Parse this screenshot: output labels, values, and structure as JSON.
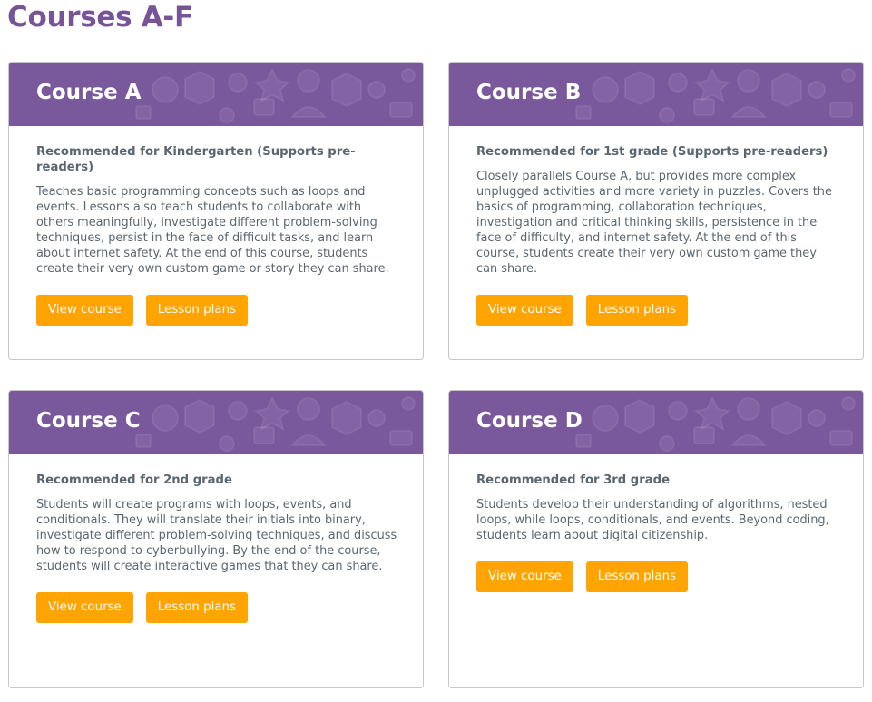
{
  "page_title": "Courses A-F",
  "colors": {
    "title": "#765496",
    "header_bg": "#7a589c",
    "button_bg": "#ffa400",
    "text": "#5b6770"
  },
  "cards": [
    {
      "title": "Course A",
      "subtitle": "Recommended for Kindergarten (Supports pre-readers)",
      "description": "Teaches basic programming concepts such as loops and events. Lessons also teach students to collaborate with others meaningfully, investigate different problem-solving techniques, persist in the face of difficult tasks, and learn about internet safety. At the end of this course, students create their very own custom game or story they can share.",
      "view_label": "View course",
      "lesson_label": "Lesson plans"
    },
    {
      "title": "Course B",
      "subtitle": "Recommended for 1st grade (Supports pre-readers)",
      "description": "Closely parallels Course A, but provides more complex unplugged activities and more variety in puzzles. Covers the basics of programming, collaboration techniques, investigation and critical thinking skills, persistence in the face of difficulty, and internet safety. At the end of this course, students create their very own custom game they can share.",
      "view_label": "View course",
      "lesson_label": "Lesson plans"
    },
    {
      "title": "Course C",
      "subtitle": "Recommended for 2nd grade",
      "description": "Students will create programs with loops, events, and conditionals. They will translate their initials into binary, investigate different problem-solving techniques, and discuss how to respond to cyberbullying. By the end of the course, students will create interactive games that they can share.",
      "view_label": "View course",
      "lesson_label": "Lesson plans"
    },
    {
      "title": "Course D",
      "subtitle": "Recommended for 3rd grade",
      "description": "Students develop their understanding of algorithms, nested loops, while loops, conditionals, and events. Beyond coding, students learn about digital citizenship.",
      "view_label": "View course",
      "lesson_label": "Lesson plans"
    }
  ]
}
